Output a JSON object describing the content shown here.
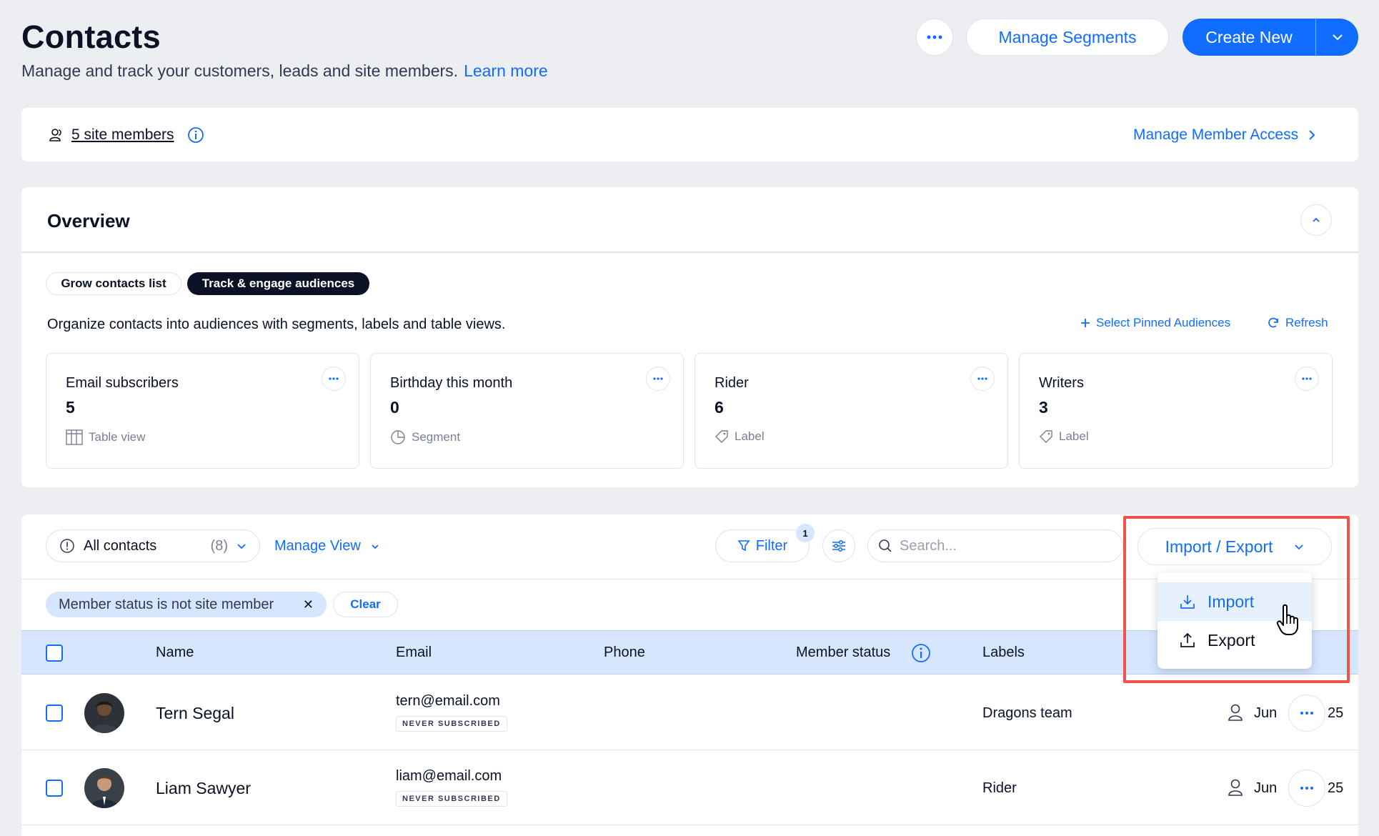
{
  "header": {
    "title": "Contacts",
    "subtitle": "Manage and track your customers, leads and site members.",
    "learn_more": "Learn more",
    "manage_segments": "Manage Segments",
    "create_new": "Create New"
  },
  "members_bar": {
    "members_link": "5 site members",
    "manage_access": "Manage Member Access"
  },
  "overview": {
    "title": "Overview",
    "tabs": [
      "Grow contacts list",
      "Track & engage audiences"
    ],
    "active_tab": "Track & engage audiences",
    "description": "Organize contacts into audiences with segments, labels and table views.",
    "select_pinned": "Select Pinned Audiences",
    "refresh": "Refresh",
    "cards": [
      {
        "title": "Email subscribers",
        "value": "5",
        "type": "Table view",
        "icon": "table-icon"
      },
      {
        "title": "Birthday this month",
        "value": "0",
        "type": "Segment",
        "icon": "segment-icon"
      },
      {
        "title": "Rider",
        "value": "6",
        "type": "Label",
        "icon": "tag-icon"
      },
      {
        "title": "Writers",
        "value": "3",
        "type": "Label",
        "icon": "tag-icon"
      }
    ]
  },
  "toolbar": {
    "view_select": "All contacts",
    "view_count": "(8)",
    "manage_view": "Manage View",
    "filter": "Filter",
    "filter_count": "1",
    "search_placeholder": "Search...",
    "import_export": "Import / Export"
  },
  "dropdown": {
    "import": "Import",
    "export": "Export"
  },
  "active_filter": {
    "chip": "Member status is not site member",
    "clear": "Clear"
  },
  "table": {
    "columns": [
      "Name",
      "Email",
      "Phone",
      "Member status",
      "Labels"
    ],
    "rows": [
      {
        "name": "Tern Segal",
        "email": "tern@email.com",
        "subscription": "NEVER SUBSCRIBED",
        "phone": "",
        "label": "Dragons team",
        "date_start": "Jun",
        "date_end": "25"
      },
      {
        "name": "Liam Sawyer",
        "email": "liam@email.com",
        "subscription": "NEVER SUBSCRIBED",
        "phone": "",
        "label": "Rider",
        "date_start": "Jun",
        "date_end": "25"
      }
    ]
  },
  "colors": {
    "accent": "#116dff",
    "background": "#eceef2",
    "table_header": "#d6e6fe",
    "highlight": "#f0524c"
  }
}
